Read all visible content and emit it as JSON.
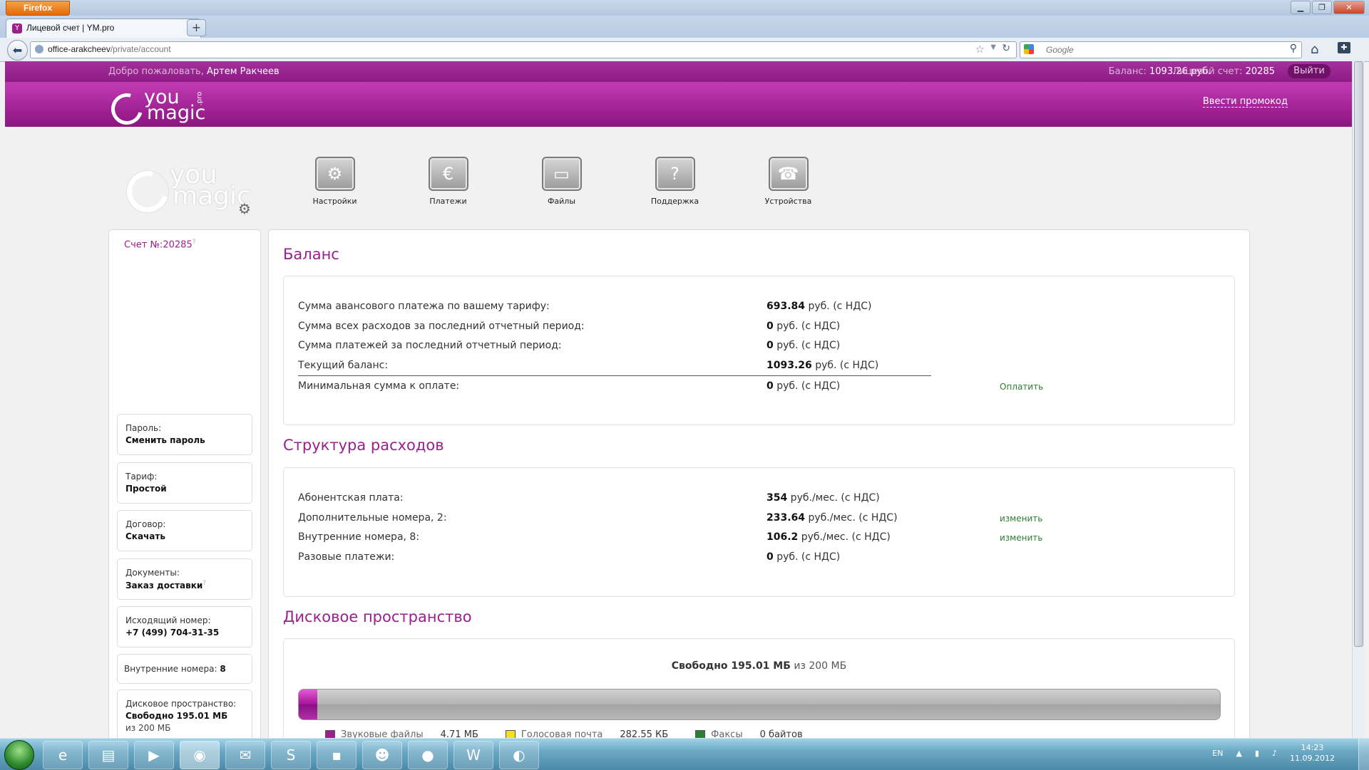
{
  "browser": {
    "app_button": "Firefox",
    "tab_title": "Лицевой счет | YM.pro",
    "url_host": "office-arakcheev",
    "url_path": "/private/account",
    "search_placeholder": "Google"
  },
  "site_header": {
    "welcome_prefix": "Добро пожаловать,",
    "user_name": "Артем Ракчеев",
    "balance_label": "Баланс:",
    "balance_value": "1093.26 руб.",
    "account_label": "Лицевой счет:",
    "account_value": "20285",
    "logout_label": "Выйти",
    "promo_link": "Ввести промокод",
    "logo_you": "you",
    "logo_magic": "magic",
    "logo_pro": ".pro"
  },
  "nav": [
    {
      "label": "Настройки",
      "icon": "settings-gears-icon"
    },
    {
      "label": "Платежи",
      "icon": "payments-icon"
    },
    {
      "label": "Файлы",
      "icon": "folder-icon"
    },
    {
      "label": "Поддержка",
      "icon": "support-question-icon"
    },
    {
      "label": "Устройства",
      "icon": "phone-device-icon"
    }
  ],
  "sidebar": {
    "account_title": "Счет №:20285",
    "password": {
      "label": "Пароль:",
      "value": "Сменить пароль"
    },
    "tariff": {
      "label": "Тариф:",
      "value": "Простой"
    },
    "contract": {
      "label": "Договор:",
      "value": "Скачать"
    },
    "documents": {
      "label": "Документы:",
      "value": "Заказ доставки"
    },
    "outgoing": {
      "label": "Исходящий номер:",
      "value": "+7 (499) 704-31-35"
    },
    "internal": {
      "label": "Внутренние номера:",
      "value": "8"
    },
    "disk": {
      "label": "Дисковое пространство:",
      "value": "Свободно 195.01 МБ",
      "sub": "из 200 МБ"
    }
  },
  "balance": {
    "title": "Баланс",
    "rows": [
      {
        "label": "Сумма авансового платежа по вашему тарифу:",
        "amount": "693.84",
        "unit": " руб. (с НДС)"
      },
      {
        "label": "Сумма всех расходов за последний отчетный период:",
        "amount": "0",
        "unit": " руб. (с НДС)"
      },
      {
        "label": "Сумма платежей за последний отчетный период:",
        "amount": "0",
        "unit": " руб. (с НДС)"
      },
      {
        "label": "Текущий баланс:",
        "amount": "1093.26",
        "unit": " руб. (с НДС)"
      },
      {
        "label": "Минимальная сумма к оплате:",
        "amount": "0",
        "unit": " руб. (с НДС)",
        "action": "Оплатить"
      }
    ]
  },
  "expenses": {
    "title": "Структура расходов",
    "rows": [
      {
        "label": "Абонентская плата:",
        "amount": "354",
        "unit": " руб./мес. (с НДС)"
      },
      {
        "label": "Дополнительные номера, 2:",
        "amount": "233.64",
        "unit": " руб./мес. (с НДС)",
        "action": "изменить"
      },
      {
        "label": "Внутренние номера, 8:",
        "amount": "106.2",
        "unit": " руб./мес. (с НДС)",
        "action": "изменить"
      },
      {
        "label": "Разовые платежи:",
        "amount": "0",
        "unit": " руб. (с НДС)"
      }
    ]
  },
  "disk": {
    "title": "Дисковое пространство",
    "free_label": "Свободно 195.01 МБ",
    "total_label": " из 200 МБ",
    "used_fraction": 0.02,
    "legend": [
      {
        "label": "Звуковые файлы",
        "size": "4.71 МБ",
        "color": "#9b1f8f"
      },
      {
        "label": "Голосовая почта",
        "size": "282.55 КБ",
        "color": "#f2e21a"
      },
      {
        "label": "Факсы",
        "size": "0 байтов",
        "color": "#2e7d32"
      }
    ]
  },
  "taskbar": {
    "lang": "EN",
    "time": "14:23",
    "date": "11.09.2012"
  },
  "colors": {
    "brand": "#9b1f8f",
    "link_green": "#2e7d32"
  }
}
